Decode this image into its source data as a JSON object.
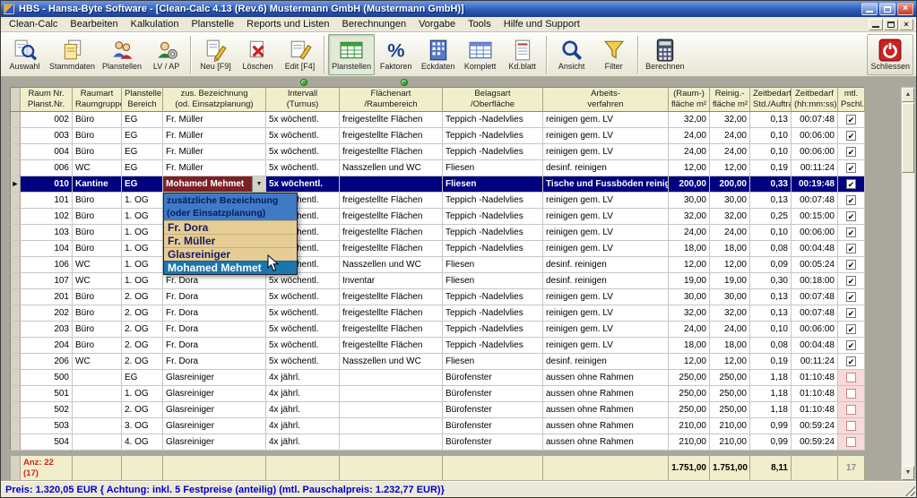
{
  "window": {
    "title": "HBS - Hansa-Byte Software - [Clean-Calc 4.13 (Rev.6) Mustermann GmbH (Mustermann GmbH)]"
  },
  "menu": {
    "items": [
      "Clean-Calc",
      "Bearbeiten",
      "Kalkulation",
      "Planstelle",
      "Reports und Listen",
      "Berechnungen",
      "Vorgabe",
      "Tools",
      "Hilfe und Support"
    ]
  },
  "toolbar": {
    "buttons": [
      {
        "label": "Auswahl",
        "icon": "magnifier-doc"
      },
      {
        "label": "Stammdaten",
        "icon": "documents"
      },
      {
        "label": "Planstellen",
        "icon": "people"
      },
      {
        "label": "LV / AP",
        "icon": "people-gear"
      },
      {
        "label": "Neu [F9]",
        "icon": "new-doc",
        "sep_before": true
      },
      {
        "label": "Löschen",
        "icon": "delete"
      },
      {
        "label": "Edit [F4]",
        "icon": "edit"
      },
      {
        "label": "Planstellen",
        "icon": "table-green",
        "sep_before": true,
        "active": true
      },
      {
        "label": "Faktoren",
        "icon": "percent"
      },
      {
        "label": "Eckdaten",
        "icon": "building"
      },
      {
        "label": "Komplett",
        "icon": "table"
      },
      {
        "label": "Kd.blatt",
        "icon": "document"
      },
      {
        "label": "Ansicht",
        "icon": "magnifier",
        "sep_before": true
      },
      {
        "label": "Filter",
        "icon": "funnel"
      },
      {
        "label": "Berechnen",
        "icon": "calculator",
        "sep_before": true
      }
    ],
    "close_label": "Schliessen"
  },
  "table": {
    "headers": [
      [
        "Raum Nr.",
        "Planst.Nr."
      ],
      [
        "Raumart",
        "Raumgruppe"
      ],
      [
        "Planstelle",
        "Bereich"
      ],
      [
        "zus. Bezeichnung",
        "(od. Einsatzplanung)"
      ],
      [
        "Intervall",
        "(Turnus)"
      ],
      [
        "Flächenart",
        "/Raumbereich"
      ],
      [
        "Belagsart",
        "/Oberfläche"
      ],
      [
        "Arbeits-",
        "verfahren"
      ],
      [
        "(Raum-)",
        "fläche m²"
      ],
      [
        "Reinig.-",
        "fläche m²"
      ],
      [
        "Zeitbedarf",
        "Std./Auftrag"
      ],
      [
        "Zeitbedarf",
        "(hh:mm:ss)"
      ],
      [
        "mtl.",
        "Pschl."
      ]
    ],
    "rows": [
      {
        "nr": "002",
        "art": "Büro",
        "bereich": "EG",
        "bez": "Fr. Müller",
        "intervall": "5x wöchentl.",
        "flaeche": "freigestellte Flächen",
        "belag": "Teppich -Nadelvlies",
        "verfahren": "reinigen gem. LV",
        "raum": "32,00",
        "reinig": "32,00",
        "std": "0,13",
        "zeit": "00:07:48",
        "pschl": true
      },
      {
        "nr": "003",
        "art": "Büro",
        "bereich": "EG",
        "bez": "Fr. Müller",
        "intervall": "5x wöchentl.",
        "flaeche": "freigestellte Flächen",
        "belag": "Teppich -Nadelvlies",
        "verfahren": "reinigen gem. LV",
        "raum": "24,00",
        "reinig": "24,00",
        "std": "0,10",
        "zeit": "00:06:00",
        "pschl": true
      },
      {
        "nr": "004",
        "art": "Büro",
        "bereich": "EG",
        "bez": "Fr. Müller",
        "intervall": "5x wöchentl.",
        "flaeche": "freigestellte Flächen",
        "belag": "Teppich -Nadelvlies",
        "verfahren": "reinigen gem. LV",
        "raum": "24,00",
        "reinig": "24,00",
        "std": "0,10",
        "zeit": "00:06:00",
        "pschl": true
      },
      {
        "nr": "006",
        "art": "WC",
        "bereich": "EG",
        "bez": "Fr. Müller",
        "intervall": "5x wöchentl.",
        "flaeche": "Nasszellen und WC",
        "belag": "Fliesen",
        "verfahren": "desinf. reinigen",
        "raum": "12,00",
        "reinig": "12,00",
        "std": "0,19",
        "zeit": "00:11:24",
        "pschl": true
      },
      {
        "nr": "010",
        "art": "Kantine",
        "bereich": "EG",
        "bez": "Mohamed Mehmet",
        "intervall": "5x wöchentl.",
        "flaeche": "",
        "belag": "Fliesen",
        "verfahren": "Tische und Fussböden reinigen",
        "raum": "200,00",
        "reinig": "200,00",
        "std": "0,33",
        "zeit": "00:19:48",
        "pschl": true,
        "selected": true
      },
      {
        "nr": "101",
        "art": "Büro",
        "bereich": "1. OG",
        "bez": "",
        "intervall": "5x wöchentl.",
        "flaeche": "freigestellte Flächen",
        "belag": "Teppich -Nadelvlies",
        "verfahren": "reinigen gem. LV",
        "raum": "30,00",
        "reinig": "30,00",
        "std": "0,13",
        "zeit": "00:07:48",
        "pschl": true
      },
      {
        "nr": "102",
        "art": "Büro",
        "bereich": "1. OG",
        "bez": "",
        "intervall": "5x wöchentl.",
        "flaeche": "freigestellte Flächen",
        "belag": "Teppich -Nadelvlies",
        "verfahren": "reinigen gem. LV",
        "raum": "32,00",
        "reinig": "32,00",
        "std": "0,25",
        "zeit": "00:15:00",
        "pschl": true
      },
      {
        "nr": "103",
        "art": "Büro",
        "bereich": "1. OG",
        "bez": "",
        "intervall": "5x wöchentl.",
        "flaeche": "freigestellte Flächen",
        "belag": "Teppich -Nadelvlies",
        "verfahren": "reinigen gem. LV",
        "raum": "24,00",
        "reinig": "24,00",
        "std": "0,10",
        "zeit": "00:06:00",
        "pschl": true
      },
      {
        "nr": "104",
        "art": "Büro",
        "bereich": "1. OG",
        "bez": "",
        "intervall": "5x wöchentl.",
        "flaeche": "freigestellte Flächen",
        "belag": "Teppich -Nadelvlies",
        "verfahren": "reinigen gem. LV",
        "raum": "18,00",
        "reinig": "18,00",
        "std": "0,08",
        "zeit": "00:04:48",
        "pschl": true
      },
      {
        "nr": "106",
        "art": "WC",
        "bereich": "1. OG",
        "bez": "",
        "intervall": "5x wöchentl.",
        "flaeche": "Nasszellen und WC",
        "belag": "Fliesen",
        "verfahren": "desinf. reinigen",
        "raum": "12,00",
        "reinig": "12,00",
        "std": "0,09",
        "zeit": "00:05:24",
        "pschl": true
      },
      {
        "nr": "107",
        "art": "WC",
        "bereich": "1. OG",
        "bez": "Fr. Dora",
        "intervall": "5x wöchentl.",
        "flaeche": "Inventar",
        "belag": "Fliesen",
        "verfahren": "desinf. reinigen",
        "raum": "19,00",
        "reinig": "19,00",
        "std": "0,30",
        "zeit": "00:18:00",
        "pschl": true
      },
      {
        "nr": "201",
        "art": "Büro",
        "bereich": "2. OG",
        "bez": "Fr. Dora",
        "intervall": "5x wöchentl.",
        "flaeche": "freigestellte Flächen",
        "belag": "Teppich -Nadelvlies",
        "verfahren": "reinigen gem. LV",
        "raum": "30,00",
        "reinig": "30,00",
        "std": "0,13",
        "zeit": "00:07:48",
        "pschl": true
      },
      {
        "nr": "202",
        "art": "Büro",
        "bereich": "2. OG",
        "bez": "Fr. Dora",
        "intervall": "5x wöchentl.",
        "flaeche": "freigestellte Flächen",
        "belag": "Teppich -Nadelvlies",
        "verfahren": "reinigen gem. LV",
        "raum": "32,00",
        "reinig": "32,00",
        "std": "0,13",
        "zeit": "00:07:48",
        "pschl": true
      },
      {
        "nr": "203",
        "art": "Büro",
        "bereich": "2. OG",
        "bez": "Fr. Dora",
        "intervall": "5x wöchentl.",
        "flaeche": "freigestellte Flächen",
        "belag": "Teppich -Nadelvlies",
        "verfahren": "reinigen gem. LV",
        "raum": "24,00",
        "reinig": "24,00",
        "std": "0,10",
        "zeit": "00:06:00",
        "pschl": true
      },
      {
        "nr": "204",
        "art": "Büro",
        "bereich": "2. OG",
        "bez": "Fr. Dora",
        "intervall": "5x wöchentl.",
        "flaeche": "freigestellte Flächen",
        "belag": "Teppich -Nadelvlies",
        "verfahren": "reinigen gem. LV",
        "raum": "18,00",
        "reinig": "18,00",
        "std": "0,08",
        "zeit": "00:04:48",
        "pschl": true
      },
      {
        "nr": "206",
        "art": "WC",
        "bereich": "2. OG",
        "bez": "Fr. Dora",
        "intervall": "5x wöchentl.",
        "flaeche": "Nasszellen und WC",
        "belag": "Fliesen",
        "verfahren": "desinf. reinigen",
        "raum": "12,00",
        "reinig": "12,00",
        "std": "0,19",
        "zeit": "00:11:24",
        "pschl": true
      },
      {
        "nr": "500",
        "art": "",
        "bereich": "EG",
        "bez": "Glasreiniger",
        "intervall": "4x jährl.",
        "flaeche": "",
        "belag": "Bürofenster",
        "verfahren": "aussen ohne Rahmen",
        "raum": "250,00",
        "reinig": "250,00",
        "std": "1,18",
        "zeit": "01:10:48",
        "pschl": false
      },
      {
        "nr": "501",
        "art": "",
        "bereich": "1. OG",
        "bez": "Glasreiniger",
        "intervall": "4x jährl.",
        "flaeche": "",
        "belag": "Bürofenster",
        "verfahren": "aussen ohne Rahmen",
        "raum": "250,00",
        "reinig": "250,00",
        "std": "1,18",
        "zeit": "01:10:48",
        "pschl": false
      },
      {
        "nr": "502",
        "art": "",
        "bereich": "2. OG",
        "bez": "Glasreiniger",
        "intervall": "4x jährl.",
        "flaeche": "",
        "belag": "Bürofenster",
        "verfahren": "aussen ohne Rahmen",
        "raum": "250,00",
        "reinig": "250,00",
        "std": "1,18",
        "zeit": "01:10:48",
        "pschl": false
      },
      {
        "nr": "503",
        "art": "",
        "bereich": "3. OG",
        "bez": "Glasreiniger",
        "intervall": "4x jährl.",
        "flaeche": "",
        "belag": "Bürofenster",
        "verfahren": "aussen ohne Rahmen",
        "raum": "210,00",
        "reinig": "210,00",
        "std": "0,99",
        "zeit": "00:59:24",
        "pschl": false
      },
      {
        "nr": "504",
        "art": "",
        "bereich": "4. OG",
        "bez": "Glasreiniger",
        "intervall": "4x jährl.",
        "flaeche": "",
        "belag": "Bürofenster",
        "verfahren": "aussen ohne Rahmen",
        "raum": "210,00",
        "reinig": "210,00",
        "std": "0,99",
        "zeit": "00:59:24",
        "pschl": false
      }
    ],
    "footer": {
      "label1": "Anz: 22",
      "label2": "(17)",
      "raum": "1.751,00",
      "reinig": "1.751,00",
      "std": "8,11",
      "count": "17"
    }
  },
  "dropdown": {
    "header_line1": "zusätzliche Bezeichnung",
    "header_line2": "(oder Einsatzplanung)",
    "items": [
      "Fr. Dora",
      "Fr. Müller",
      "Glasreiniger",
      "Mohamed Mehmet"
    ],
    "selected": "Mohamed Mehmet"
  },
  "statusbar": {
    "text": "Preis: 1.320,05 EUR { Achtung: inkl. 5 Festpreise (anteilig) (mtl. Pauschalpreis: 1.232,77 EUR)}"
  },
  "colors": {
    "selection_bg": "#00007f",
    "combo_cell_bg": "#7b2125",
    "dropdown_header_bg": "#3f7ac6",
    "dropdown_item_bg": "#e6cd96",
    "dropdown_selected_bg": "#1b75af",
    "header_bg": "#f1eecb",
    "pink_cell_bg": "#f9d9d9",
    "status_text": "#0000cc",
    "indicator_green": "#2fae2f",
    "titlebar_blue": "#2d5cb8"
  }
}
